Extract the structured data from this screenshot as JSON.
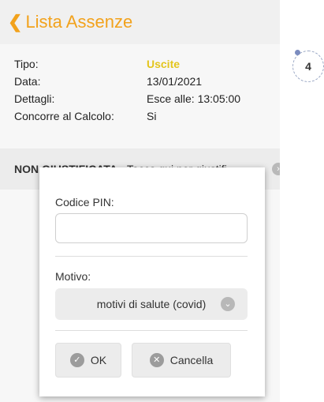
{
  "header": {
    "back_icon": "❮",
    "title": "Lista Assenze"
  },
  "details": {
    "tipo_label": "Tipo:",
    "tipo_value": "Uscite",
    "data_label": "Data:",
    "data_value": "13/01/2021",
    "dettagli_label": "Dettagli:",
    "dettagli_value": "Esce alle: 13:05:00",
    "concorre_label": "Concorre al Calcolo:",
    "concorre_value": "Si"
  },
  "status": {
    "label": "NON GIUSTIFICATA",
    "hint": "Tocca qui per giustifi",
    "arrow_icon": "›"
  },
  "badge": {
    "number": "4"
  },
  "dialog": {
    "pin_label": "Codice PIN:",
    "pin_value": "",
    "motivo_label": "Motivo:",
    "motivo_value": "motivi di salute (covid)",
    "chevron_icon": "⌄",
    "ok_icon": "✓",
    "ok_label": "OK",
    "cancel_icon": "✕",
    "cancel_label": "Cancella"
  },
  "colors": {
    "accent": "#f2a21c",
    "tipo_value": "#e3c51c",
    "badge_dot": "#7b8cbf"
  }
}
